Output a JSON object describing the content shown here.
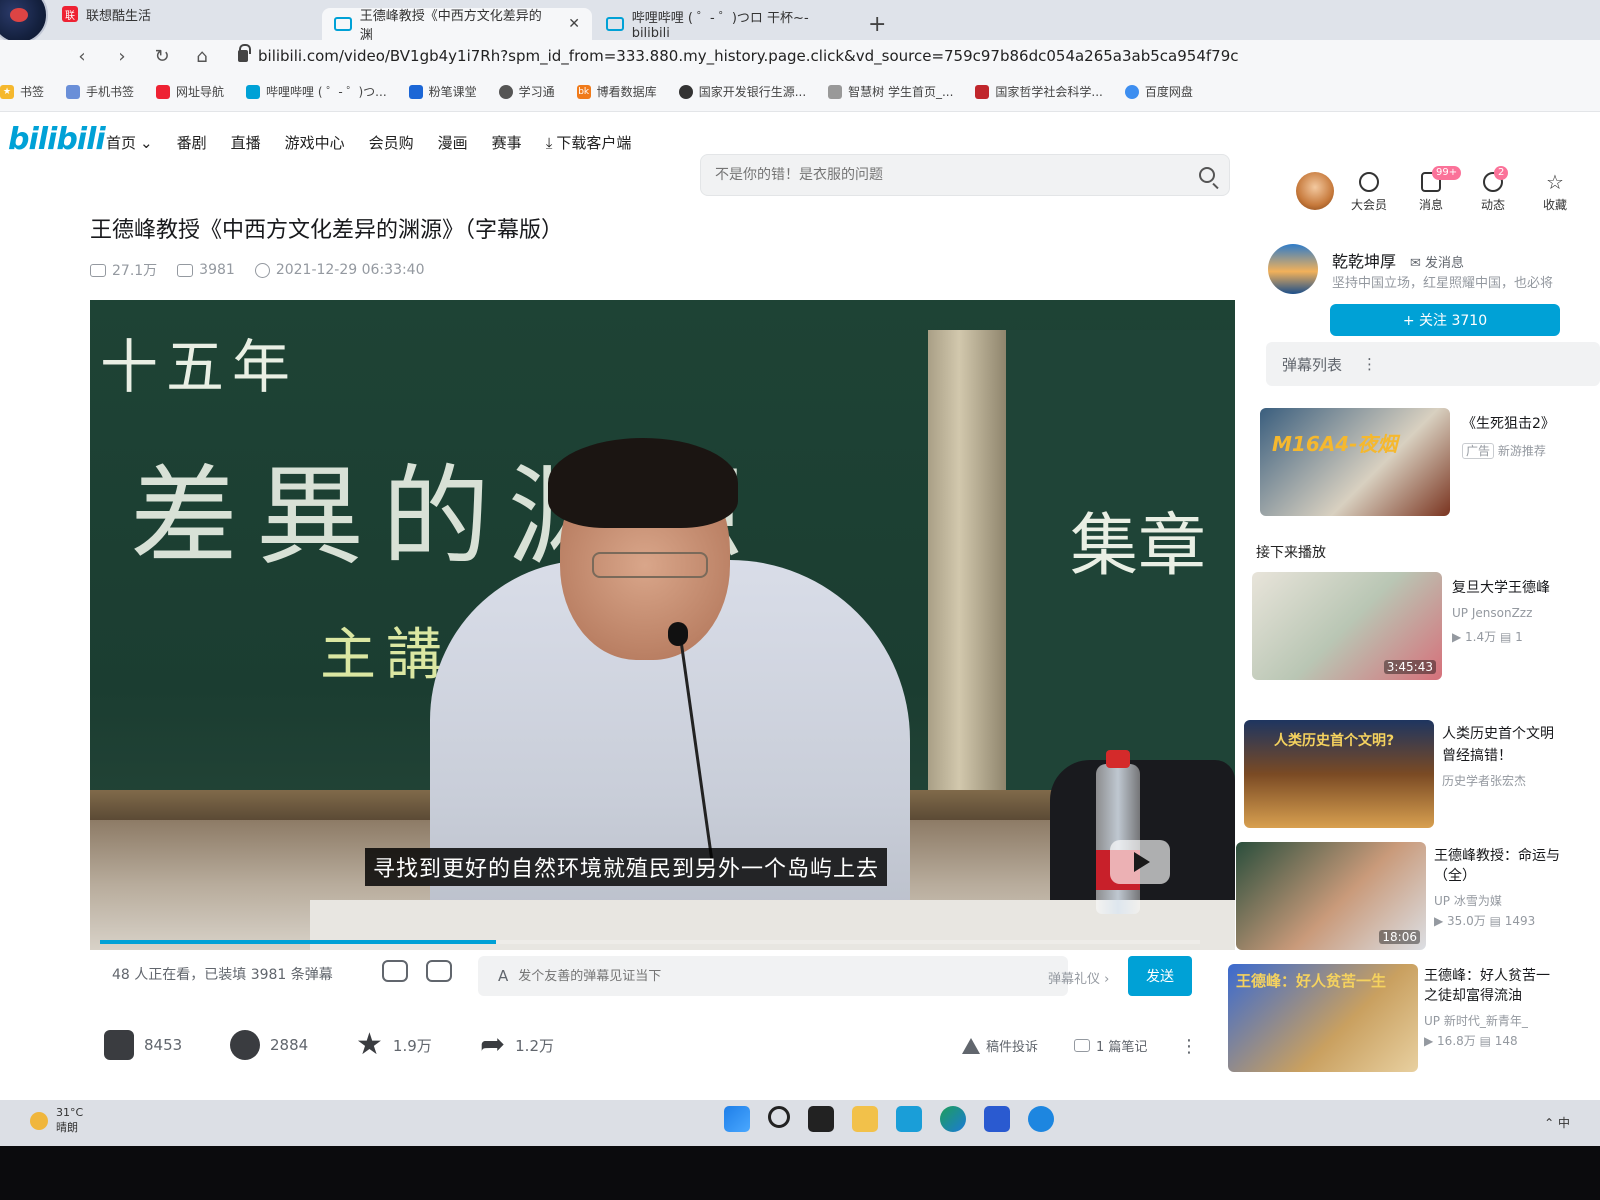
{
  "browser": {
    "pinned_tab": "联想酷生活",
    "tabs": [
      {
        "label": "王德峰教授《中西方文化差异的渊",
        "active": true
      },
      {
        "label": "哔哩哔哩 ( ゜- ゜)つロ 干杯~-bilibili",
        "active": false
      }
    ],
    "url": "bilibili.com/video/BV1gb4y1i7Rh?spm_id_from=333.880.my_history.page.click&vd_source=759c97b86dc054a265a3ab5ca954f79c",
    "bookmarks": [
      "书签",
      "手机书签",
      "网址导航",
      "哔哩哔哩 ( ゜- ゜)つ...",
      "粉笔课堂",
      "学习通",
      "博看数据库",
      "国家开发银行生源...",
      "智慧树 学生首页_...",
      "国家哲学社会科学...",
      "百度网盘"
    ]
  },
  "header": {
    "logo": "bilibili",
    "menu": [
      "首页",
      "番剧",
      "直播",
      "游戏中心",
      "会员购",
      "漫画",
      "赛事",
      "下载客户端"
    ],
    "search_placeholder": "不是你的错！是衣服的问题",
    "icons": [
      {
        "label": "大会员",
        "badge": ""
      },
      {
        "label": "消息",
        "badge": "99+"
      },
      {
        "label": "动态",
        "badge": "2"
      },
      {
        "label": "收藏",
        "badge": ""
      }
    ]
  },
  "video": {
    "title": "王德峰教授《中西方文化差异的渊源》（字幕版）",
    "views": "27.1万",
    "danmaku_count": "3981",
    "published": "2021-12-29 06:33:40",
    "chalk_top": "十五年",
    "chalk_main": "差異的渊源",
    "chalk_mid": "主講人",
    "chalk_right": "集章",
    "subtitle": "寻找到更好的自然环境就殖民到另外一个岛屿上去",
    "progress": 0.36
  },
  "danmaku_bar": {
    "watching": "48 人正在看，已装填 3981 条弹幕",
    "input_placeholder": "发个友善的弹幕见证当下",
    "etiquette": "弹幕礼仪 ›",
    "send": "发送"
  },
  "toolbar": {
    "like": "8453",
    "coin": "2884",
    "favorite": "1.9万",
    "share": "1.2万",
    "report": "稿件投诉",
    "notes": "1 篇笔记"
  },
  "uploader": {
    "name": "乾乾坤厚",
    "message": "发消息",
    "desc": "坚持中国立场，红星照耀中国，也必将",
    "follow": "+ 关注 3710"
  },
  "sidebar": {
    "danmaku_list": "弹幕列表",
    "up_next": "接下来播放",
    "ad": {
      "title": "《生死狙击2》",
      "tag": "广告",
      "sub": "新游推荐",
      "thumb_text": "M16A4-夜烟"
    },
    "recs": [
      {
        "title": "复旦大学王德峰",
        "author": "JensonZzz",
        "views": "1.4万",
        "danmaku": "1",
        "duration": "3:45:43"
      },
      {
        "title": "人类历史首个文明",
        "title2": "曾经搞错！",
        "author": "历史学者张宏杰",
        "thumb_text": "人类历史首个文明?"
      },
      {
        "title": "王德峰教授：命运与",
        "title2": "（全）",
        "author": "冰雪为媒",
        "views": "35.0万",
        "danmaku": "1493",
        "duration": "18:06"
      },
      {
        "title": "王德峰：好人贫苦一",
        "title2": "之徒却富得流油",
        "author": "新时代_新青年_",
        "views": "16.8万",
        "danmaku": "148",
        "thumb_text": "王德峰：好人贫苦一生"
      }
    ]
  },
  "taskbar": {
    "temp": "31°C",
    "weather": "晴朗",
    "ime": "中"
  }
}
